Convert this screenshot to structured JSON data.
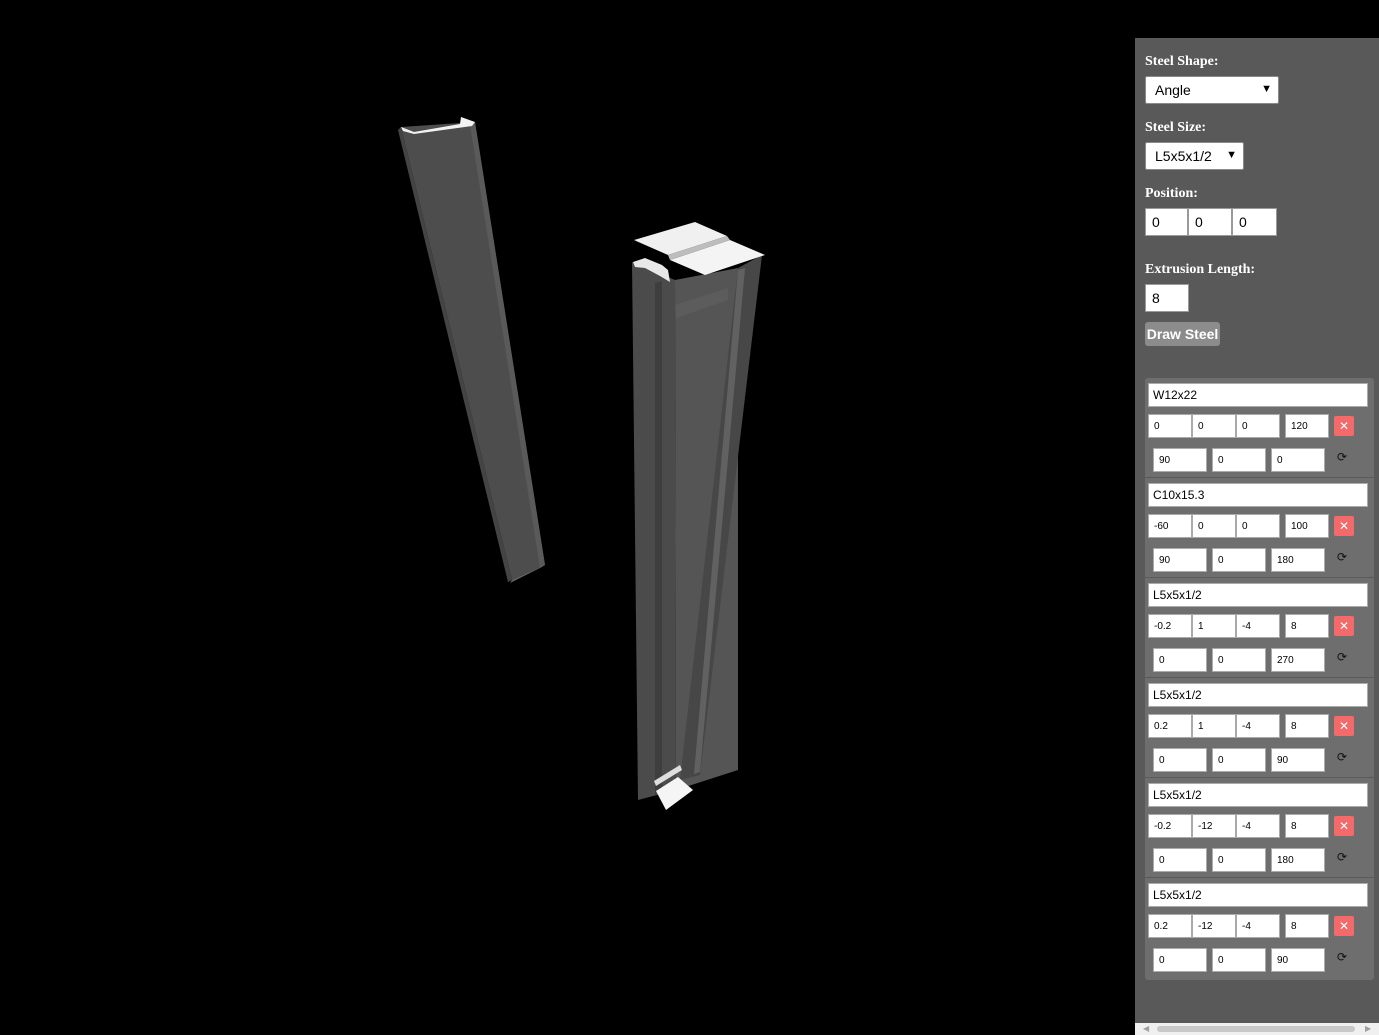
{
  "form": {
    "shape_label": "Steel Shape:",
    "shape_value": "Angle",
    "size_label": "Steel Size:",
    "size_value": "L5x5x1/2",
    "position_label": "Position:",
    "position": [
      "0",
      "0",
      "0"
    ],
    "extrusion_label": "Extrusion Length:",
    "extrusion_value": "8",
    "draw_button": "Draw Steel"
  },
  "members": [
    {
      "name": "W12x22",
      "pos": [
        "0",
        "0",
        "0"
      ],
      "length": "120",
      "rot": [
        "90",
        "0",
        "0"
      ]
    },
    {
      "name": "C10x15.3",
      "pos": [
        "-60",
        "0",
        "0"
      ],
      "length": "100",
      "rot": [
        "90",
        "0",
        "180"
      ]
    },
    {
      "name": "L5x5x1/2",
      "pos": [
        "-0.2",
        "1",
        "-4"
      ],
      "length": "8",
      "rot": [
        "0",
        "0",
        "270"
      ]
    },
    {
      "name": "L5x5x1/2",
      "pos": [
        "0.2",
        "1",
        "-4"
      ],
      "length": "8",
      "rot": [
        "0",
        "0",
        "90"
      ]
    },
    {
      "name": "L5x5x1/2",
      "pos": [
        "-0.2",
        "-12",
        "-4"
      ],
      "length": "8",
      "rot": [
        "0",
        "0",
        "180"
      ]
    },
    {
      "name": "L5x5x1/2",
      "pos": [
        "0.2",
        "-12",
        "-4"
      ],
      "length": "8",
      "rot": [
        "0",
        "0",
        "90"
      ]
    }
  ],
  "icons": {
    "delete": "close-icon",
    "rotate": "refresh-icon",
    "dropdown": "chevron-down-icon"
  },
  "colors": {
    "viewport_bg": "#000000",
    "panel_bg": "#595959",
    "delete_button": "#f36a6a",
    "steel": "#4a4a4a"
  }
}
